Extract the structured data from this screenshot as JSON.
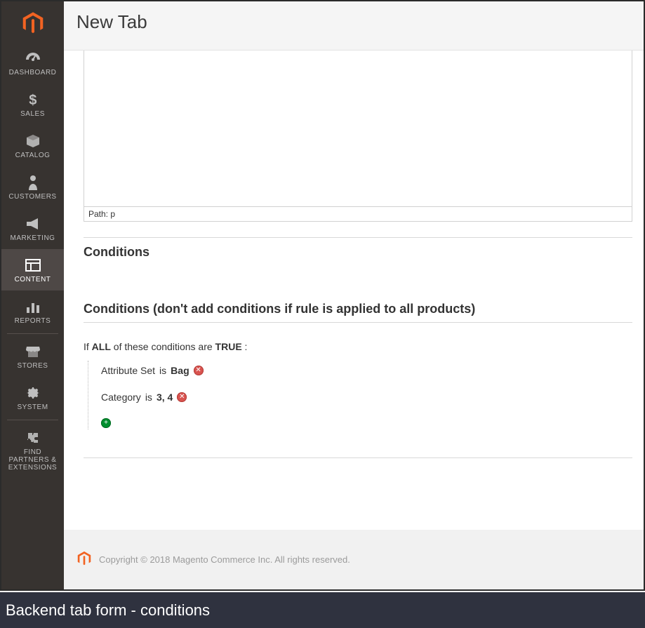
{
  "header": {
    "page_title": "New Tab"
  },
  "sidebar": {
    "items": [
      {
        "name": "dashboard",
        "label": "DASHBOARD"
      },
      {
        "name": "sales",
        "label": "SALES"
      },
      {
        "name": "catalog",
        "label": "CATALOG"
      },
      {
        "name": "customers",
        "label": "CUSTOMERS"
      },
      {
        "name": "marketing",
        "label": "MARKETING"
      },
      {
        "name": "content",
        "label": "CONTENT",
        "active": true
      },
      {
        "name": "reports",
        "label": "REPORTS"
      },
      {
        "name": "stores",
        "label": "STORES"
      },
      {
        "name": "system",
        "label": "SYSTEM"
      },
      {
        "name": "find-partners",
        "label": "FIND PARTNERS & EXTENSIONS"
      }
    ]
  },
  "editor": {
    "path_label": "Path: p"
  },
  "conditions": {
    "section_title": "Conditions",
    "subsection_title": "Conditions (don't add conditions if rule is applied to all products)",
    "sentence": {
      "prefix": "If ",
      "aggregator": "ALL",
      "middle": "  of these conditions are ",
      "value": "TRUE",
      "suffix": " :"
    },
    "rules": [
      {
        "attribute": "Attribute Set",
        "operator": "is",
        "value": "Bag"
      },
      {
        "attribute": "Category",
        "operator": "is",
        "value": "3, 4"
      }
    ]
  },
  "footer": {
    "copyright": "Copyright © 2018 Magento Commerce Inc. All rights reserved."
  },
  "caption": "Backend tab form - conditions"
}
